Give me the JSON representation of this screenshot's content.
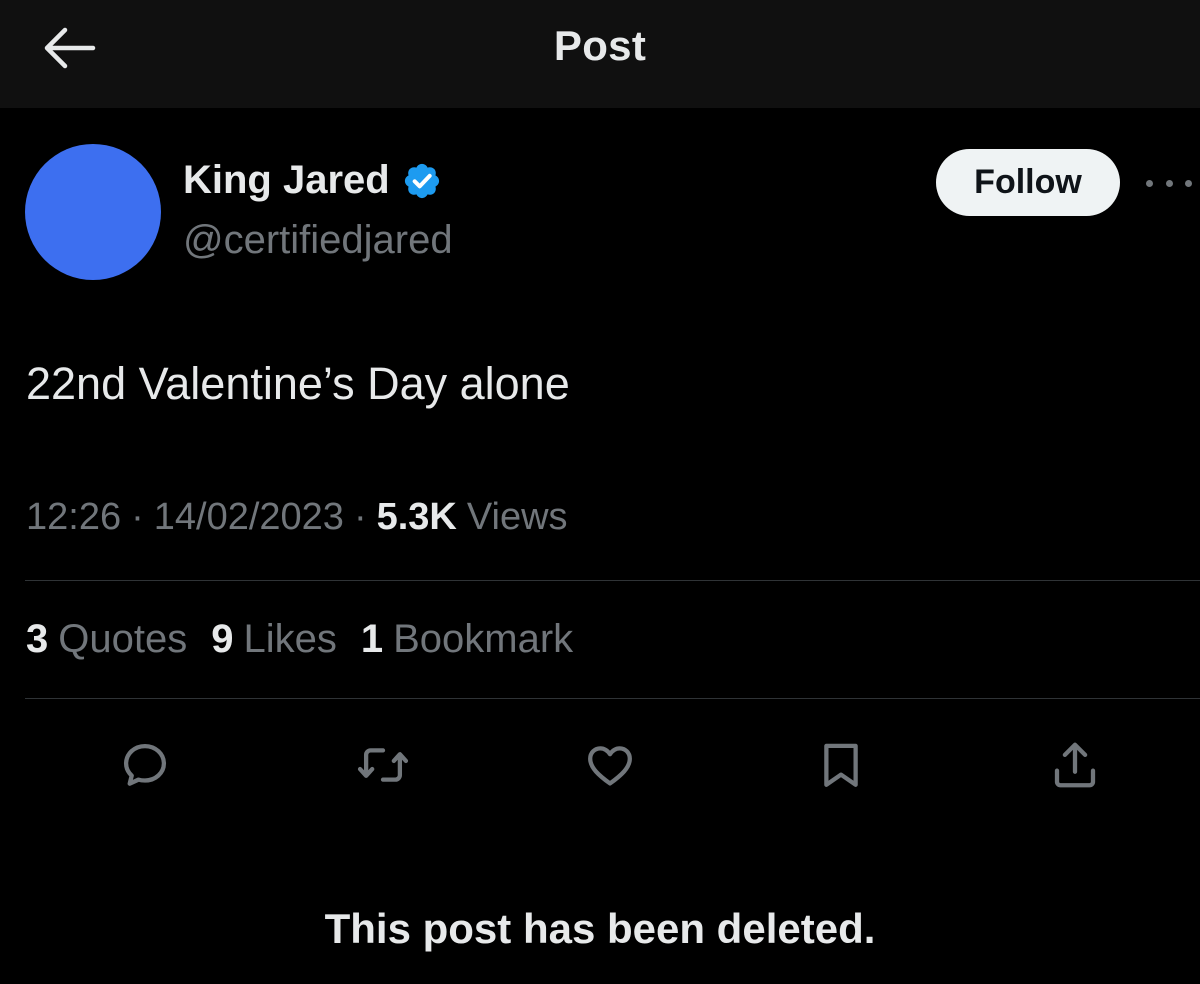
{
  "header": {
    "title": "Post",
    "back_icon": "arrow-left-icon"
  },
  "author": {
    "display_name": "King Jared",
    "handle": "@certifiedjared",
    "verified": true,
    "avatar_color": "#3d6ff0"
  },
  "follow_label": "Follow",
  "post": {
    "text": "22nd Valentine’s Day alone",
    "time": "12:26",
    "date": "14/02/2023",
    "views_count": "5.3K",
    "views_label": "Views"
  },
  "stats": {
    "quotes_count": "3",
    "quotes_label": "Quotes",
    "likes_count": "9",
    "likes_label": "Likes",
    "bookmarks_count": "1",
    "bookmarks_label": "Bookmark"
  },
  "actions": [
    "reply-icon",
    "repost-icon",
    "like-icon",
    "bookmark-icon",
    "share-icon"
  ],
  "notice": "This post has been deleted.",
  "colors": {
    "background": "#000000",
    "header_bg": "#101010",
    "primary_text": "#e7e9ea",
    "secondary_text": "#71767b",
    "verified_blue": "#1d9bf0",
    "divider": "#2f3336"
  }
}
